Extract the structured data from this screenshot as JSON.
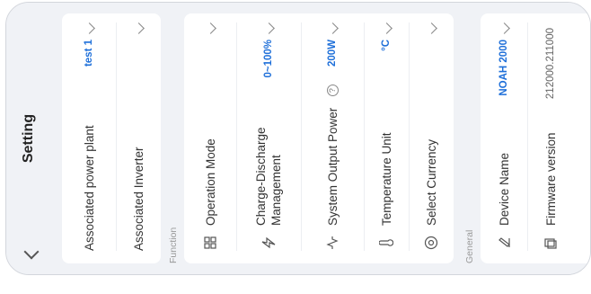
{
  "header": {
    "title": "Setting"
  },
  "card1": {
    "rows": [
      {
        "label": "Associated power plant",
        "value": "test 1"
      },
      {
        "label": "Associated Inverter",
        "value": ""
      }
    ]
  },
  "function_section": {
    "title": "Function",
    "rows": [
      {
        "icon": "grid-icon",
        "label": "Operation Mode",
        "value": ""
      },
      {
        "icon": "charge-icon",
        "label": "Charge-Discharge Management",
        "value": "0~100%"
      },
      {
        "icon": "output-icon",
        "label": "System Output Power",
        "value": "200W",
        "help": "?"
      },
      {
        "icon": "thermometer-icon",
        "label": "Temperature Unit",
        "value": "°C"
      },
      {
        "icon": "currency-icon",
        "label": "Select Currency",
        "value": ""
      }
    ]
  },
  "general_section": {
    "title": "General",
    "rows": [
      {
        "icon": "pencil-icon",
        "label": "Device Name",
        "value": "NOAH 2000"
      },
      {
        "icon": "firmware-icon",
        "label": "Firmware version",
        "value": "212000.211000"
      }
    ]
  },
  "colors": {
    "accent": "#1e6fd9",
    "background": "#f0f2f6",
    "card": "#ffffff"
  }
}
